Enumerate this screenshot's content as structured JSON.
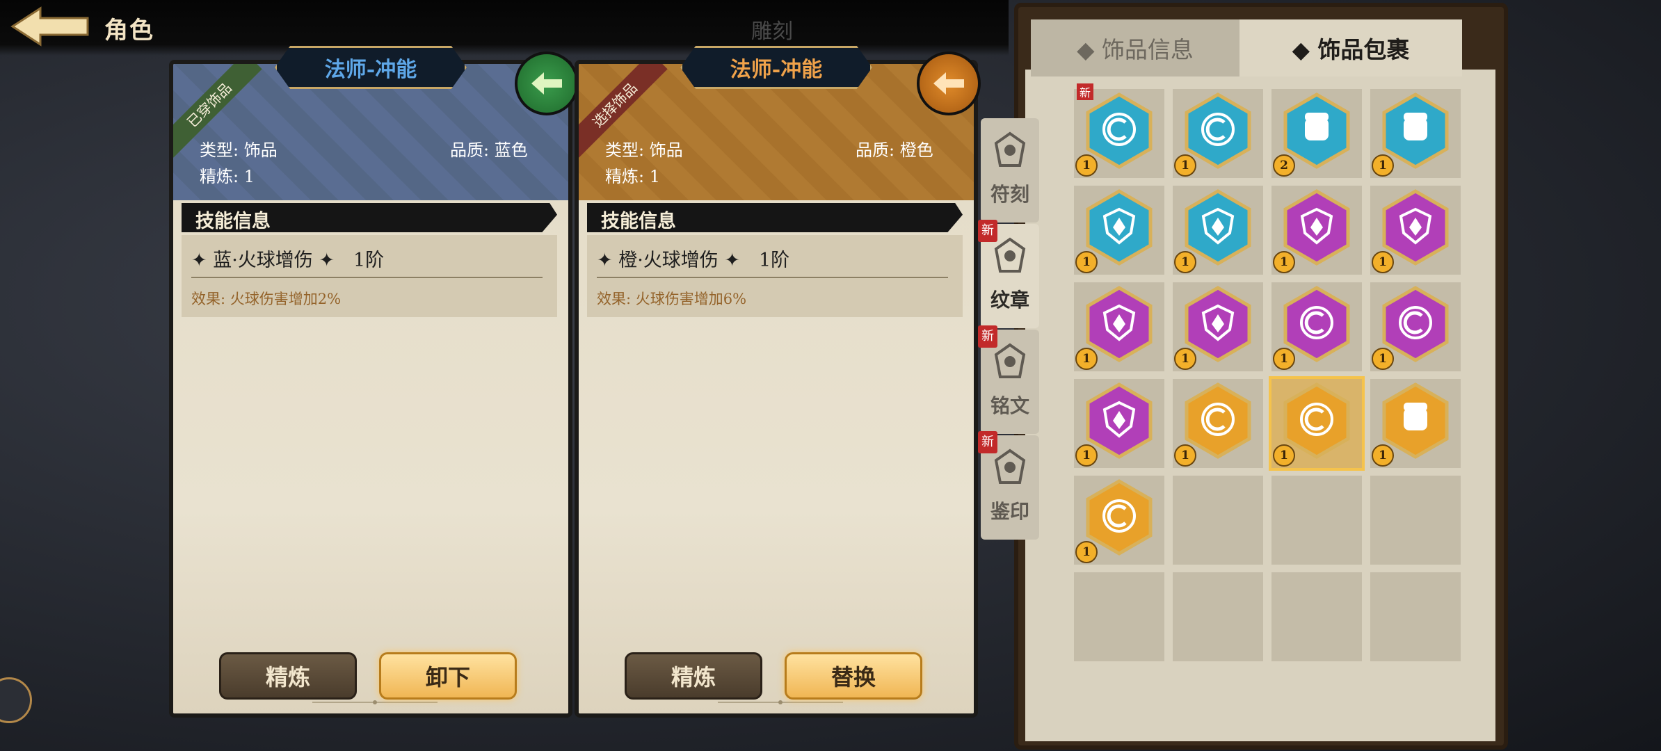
{
  "header": {
    "title": "角色",
    "ghost": "雕刻"
  },
  "left_card": {
    "badge": "已穿饰品",
    "name": "法师-冲能",
    "type": "类型: 饰品",
    "quality": "品质: 蓝色",
    "refine": "精炼: 1",
    "section": "技能信息",
    "skill_name": "✦ 蓝·火球增伤 ✦　1阶",
    "effect": "效果: 火球伤害增加2%",
    "btn1": "精炼",
    "btn2": "卸下"
  },
  "right_card": {
    "badge": "选择饰品",
    "name": "法师-冲能",
    "type": "类型: 饰品",
    "quality": "品质: 橙色",
    "refine": "精炼: 1",
    "section": "技能信息",
    "skill_name": "✦ 橙·火球增伤 ✦　1阶",
    "effect": "效果: 火球伤害增加6%",
    "btn1": "精炼",
    "btn2": "替换"
  },
  "side_tabs": [
    {
      "label": "符刻",
      "icon": "rune-icon",
      "new": false,
      "active": false
    },
    {
      "label": "纹章",
      "icon": "emblem-icon",
      "new": true,
      "active": true
    },
    {
      "label": "铭文",
      "icon": "inscription-icon",
      "new": true,
      "active": false
    },
    {
      "label": "鉴印",
      "icon": "seal-icon",
      "new": true,
      "active": false
    }
  ],
  "new_badge": "新",
  "panel": {
    "tab_info": "◆ 饰品信息",
    "tab_bag": "◆ 饰品包裹"
  },
  "inventory": [
    {
      "color": "blue",
      "glyph": "hex-c",
      "level": "1",
      "new": true
    },
    {
      "color": "blue",
      "glyph": "hex-c",
      "level": "1",
      "new": false
    },
    {
      "color": "blue",
      "glyph": "fist",
      "level": "2",
      "new": false
    },
    {
      "color": "blue",
      "glyph": "fist",
      "level": "1",
      "new": false
    },
    {
      "color": "blue",
      "glyph": "shield",
      "level": "1",
      "new": false
    },
    {
      "color": "blue",
      "glyph": "shield",
      "level": "1",
      "new": false
    },
    {
      "color": "purple",
      "glyph": "shield",
      "level": "1",
      "new": false
    },
    {
      "color": "purple",
      "glyph": "shield",
      "level": "1",
      "new": false
    },
    {
      "color": "purple",
      "glyph": "shield",
      "level": "1",
      "new": false
    },
    {
      "color": "purple",
      "glyph": "shield",
      "level": "1",
      "new": false
    },
    {
      "color": "purple",
      "glyph": "hex-c",
      "level": "1",
      "new": false
    },
    {
      "color": "purple",
      "glyph": "hex-c",
      "level": "1",
      "new": false
    },
    {
      "color": "purple",
      "glyph": "shield",
      "level": "1",
      "new": false
    },
    {
      "color": "orange",
      "glyph": "hex-c",
      "level": "1",
      "new": false
    },
    {
      "color": "orange",
      "glyph": "hex-c",
      "level": "1",
      "new": false,
      "selected": true
    },
    {
      "color": "orange",
      "glyph": "fist",
      "level": "1",
      "new": false
    },
    {
      "color": "orange",
      "glyph": "hex-c",
      "level": "1",
      "new": false
    }
  ],
  "colors": {
    "blue": "#2fa9c9",
    "purple": "#b13fb8",
    "orange": "#e8a12a"
  }
}
